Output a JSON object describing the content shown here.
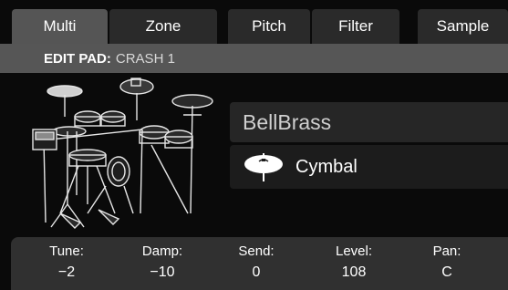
{
  "tabs": [
    {
      "label": "Multi",
      "active": true
    },
    {
      "label": "Zone",
      "active": false
    },
    {
      "label": "Pitch",
      "active": false
    },
    {
      "label": "Filter",
      "active": false
    },
    {
      "label": "Sample",
      "active": false
    }
  ],
  "edit_bar": {
    "key": "EDIT PAD:",
    "value": "CRASH 1"
  },
  "kit_image": {
    "icon": "drum-kit-icon"
  },
  "sound": {
    "name": "BellBrass",
    "category_icon": "cymbal-icon",
    "category": "Cymbal"
  },
  "params": [
    {
      "label": "Tune:",
      "value": "−2"
    },
    {
      "label": "Damp:",
      "value": "−10"
    },
    {
      "label": "Send:",
      "value": "0"
    },
    {
      "label": "Level:",
      "value": "108"
    },
    {
      "label": "Pan:",
      "value": "C"
    }
  ],
  "colors": {
    "active_tab": "#555555",
    "tab": "#2a2a2a",
    "edit_bar": "#565656",
    "param_bar": "#303030"
  }
}
